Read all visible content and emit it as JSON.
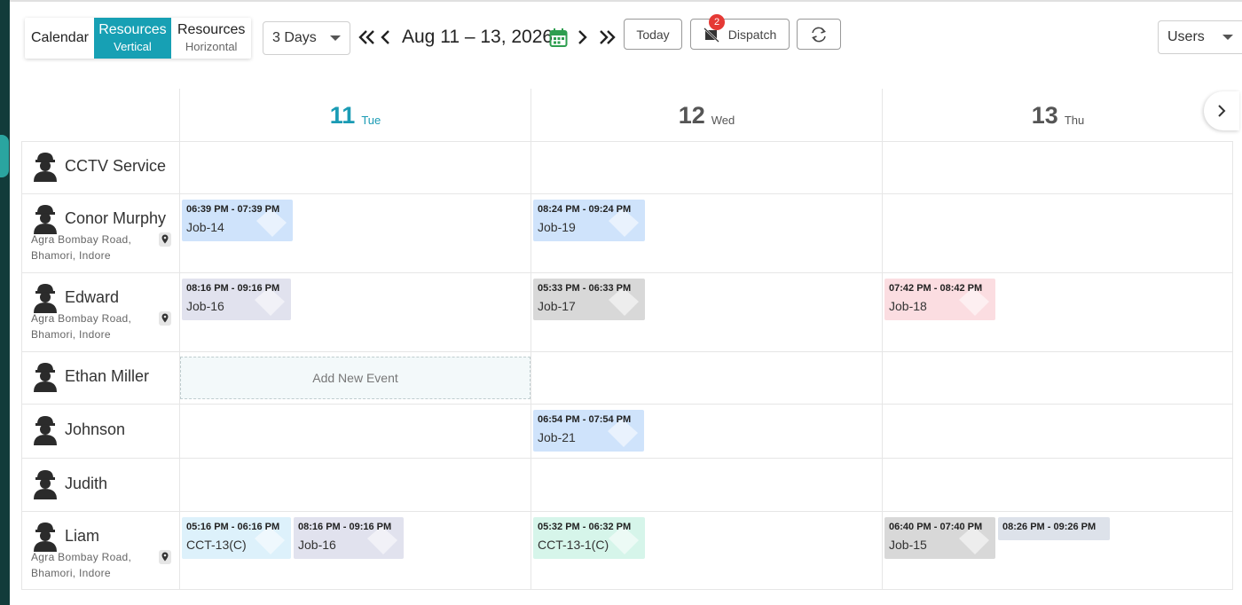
{
  "toolbar": {
    "view_calendar": "Calendar",
    "view_res_vertical_l1": "Resources",
    "view_res_vertical_l2": "Vertical",
    "view_res_horizontal_l1": "Resources",
    "view_res_horizontal_l2": "Horizontal",
    "range_select": "3 Days",
    "date_range": "Aug 11 – 13, 2026",
    "today_label": "Today",
    "dispatch_label": "Dispatch",
    "dispatch_badge": "2",
    "users_select": "Users"
  },
  "days": [
    {
      "num": "11",
      "name": "Tue",
      "today": true
    },
    {
      "num": "12",
      "name": "Wed",
      "today": false
    },
    {
      "num": "13",
      "name": "Thu",
      "today": false
    }
  ],
  "resources": [
    {
      "name": "CCTV Service",
      "addr1": "",
      "addr2": ""
    },
    {
      "name": "Conor Murphy",
      "addr1": "Agra Bombay Road,",
      "addr2": "Bhamori, Indore"
    },
    {
      "name": "Edward",
      "addr1": "Agra Bombay Road,",
      "addr2": "Bhamori, Indore"
    },
    {
      "name": "Ethan Miller",
      "addr1": "",
      "addr2": ""
    },
    {
      "name": "Johnson",
      "addr1": "",
      "addr2": ""
    },
    {
      "name": "Judith",
      "addr1": "",
      "addr2": ""
    },
    {
      "name": "Liam",
      "addr1": "Agra Bombay Road,",
      "addr2": "Bhamori, Indore"
    }
  ],
  "events": [
    {
      "time": "06:39 PM - 07:39 PM",
      "title": "Job-14",
      "color": "#cfe3fb"
    },
    {
      "time": "08:24 PM - 09:24 PM",
      "title": "Job-19",
      "color": "#cfe3fb"
    },
    {
      "time": "08:16 PM - 09:16 PM",
      "title": "Job-16",
      "color": "#e1e2ee"
    },
    {
      "time": "05:33 PM - 06:33 PM",
      "title": "Job-17",
      "color": "#d8d8d8"
    },
    {
      "time": "07:42 PM - 08:42 PM",
      "title": "Job-18",
      "color": "#fbdde1"
    },
    {
      "time": "06:54 PM - 07:54 PM",
      "title": "Job-21",
      "color": "#cfe3fb"
    },
    {
      "time": "05:16 PM - 06:16 PM",
      "title": "CCT-13(C)",
      "color": "#ddf1fb"
    },
    {
      "time": "08:16 PM - 09:16 PM",
      "title": "Job-16",
      "color": "#e1e2ee"
    },
    {
      "time": "05:32 PM - 06:32 PM",
      "title": "CCT-13-1(C)",
      "color": "#d6f5ea"
    },
    {
      "time": "06:40 PM - 07:40 PM",
      "title": "Job-15",
      "color": "#d8d8d8"
    },
    {
      "time": "08:26 PM - 09:26 PM",
      "title": "",
      "color": "#dde2ea"
    }
  ],
  "add_event_label": "Add New Event"
}
